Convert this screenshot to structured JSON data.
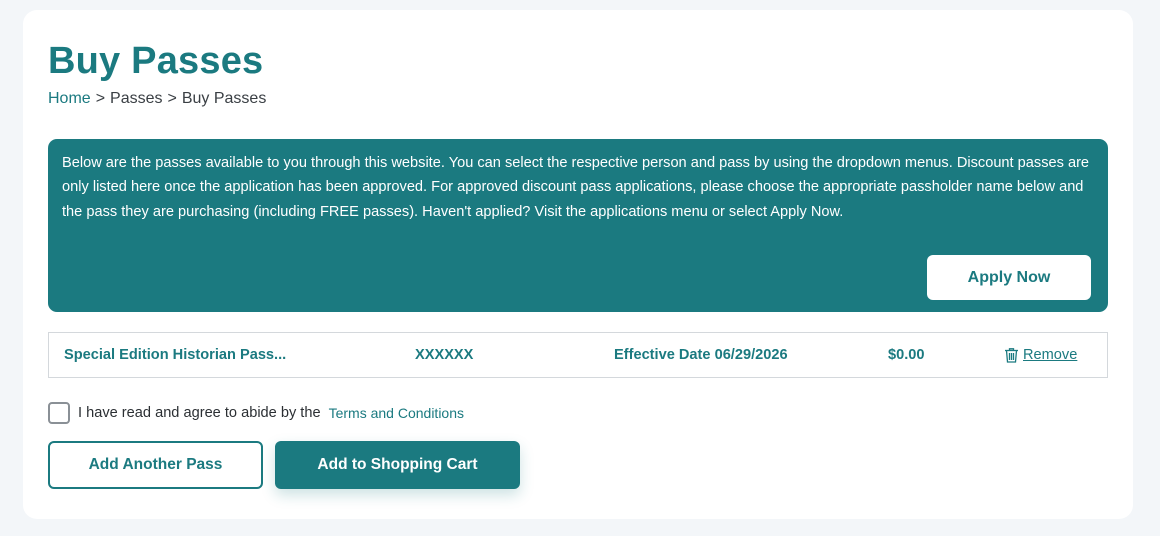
{
  "page": {
    "title": "Buy Passes"
  },
  "breadcrumb": {
    "items": [
      "Home",
      "Passes",
      "Buy Passes"
    ],
    "separator": ">"
  },
  "info_panel": {
    "text": "Below are the passes available to you through this website. You can select the respective person and pass by using the dropdown menus. Discount passes are only listed here once the application has been approved. For approved discount pass applications, please choose the appropriate passholder name below and the pass they are purchasing (including FREE passes). Haven't applied? Visit the applications menu or select Apply Now.",
    "apply_button_label": "Apply Now"
  },
  "pass_row": {
    "name": "Special Edition Historian Pass...",
    "passholder": "XXXXXX",
    "effective_date": "Effective Date 06/29/2026",
    "price": "$0.00",
    "remove_label": "Remove",
    "remove_icon": "trash-icon"
  },
  "terms": {
    "checked": false,
    "text": "I have read and agree to abide by the",
    "link_label": "Terms and Conditions"
  },
  "actions": {
    "add_another_label": "Add Another Pass",
    "add_to_cart_label": "Add to Shopping Cart"
  },
  "colors": {
    "brand": "#1b7a80",
    "background": "#f3f6f9",
    "card": "#ffffff"
  }
}
